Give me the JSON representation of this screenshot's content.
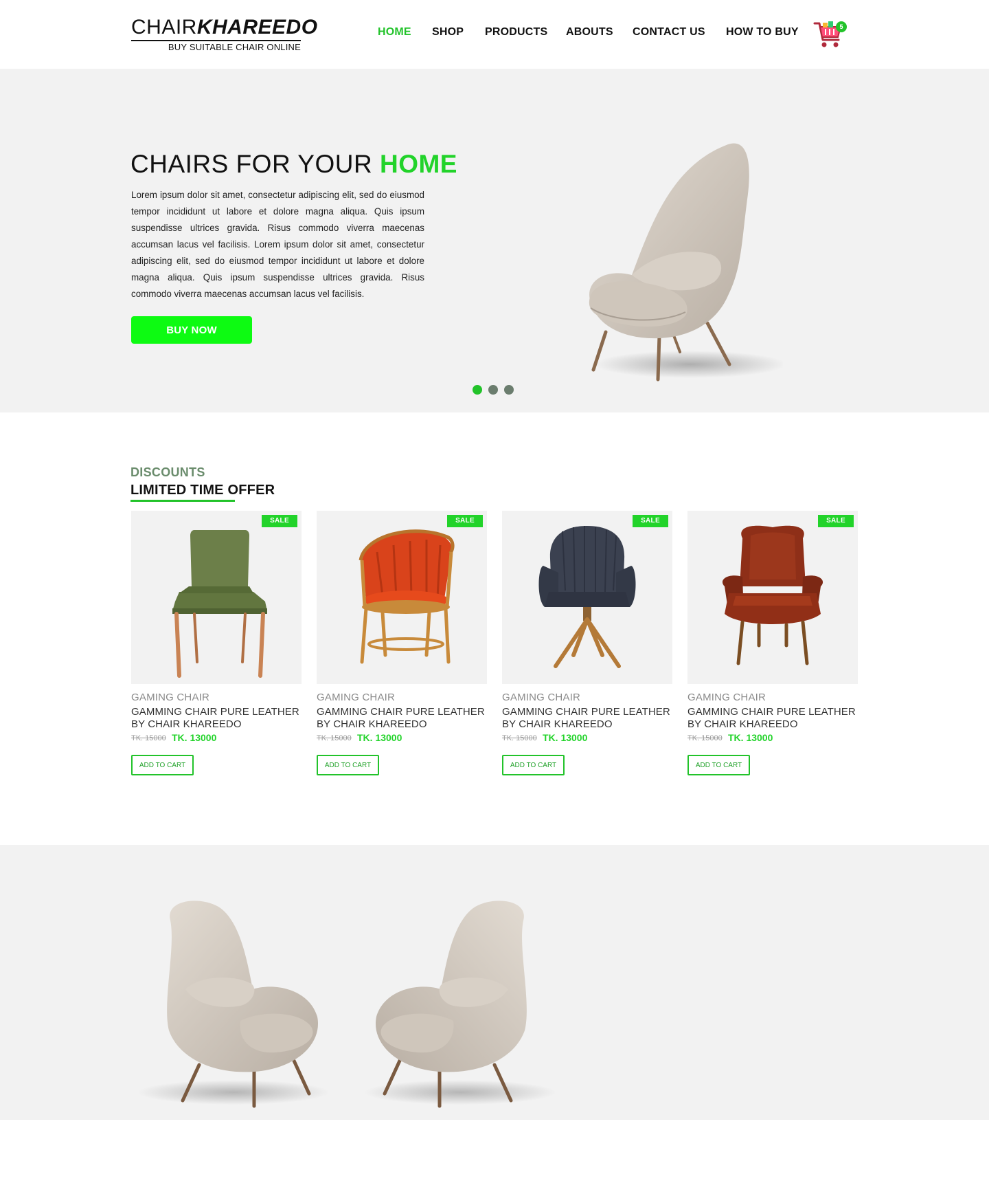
{
  "brand": {
    "name_thin": "CHAIR",
    "name_bold": "KHAREEDO",
    "tagline": "BUY SUITABLE CHAIR ONLINE"
  },
  "nav": {
    "home": "HOME",
    "shop": "SHOP",
    "products": "PRODUCTS",
    "abouts": "ABOUTS",
    "contact": "CONTACT US",
    "howto": "HOW TO BUY"
  },
  "cart": {
    "count": "5",
    "icon": "shopping-cart-icon"
  },
  "hero": {
    "title_plain": "CHAIRS FOR YOUR ",
    "title_accent": "HOME",
    "body": "Lorem ipsum dolor sit amet, consectetur adipiscing elit, sed do eiusmod tempor incididunt ut labore et dolore magna aliqua. Quis ipsum suspendisse ultrices gravida. Risus commodo viverra maecenas accumsan lacus vel facilisis. Lorem ipsum dolor sit amet, consectetur adipiscing elit, sed do eiusmod tempor incididunt ut labore et dolore magna aliqua. Quis ipsum suspendisse ultrices gravida. Risus commodo viverra maecenas accumsan lacus vel facilisis.",
    "button": "BUY NOW",
    "slides": 3,
    "active_slide": 1
  },
  "discounts": {
    "eyebrow": "DISCOUNTS",
    "title": "LIMITED TIME OFFER",
    "products": [
      {
        "badge": "SALE",
        "category": "GAMING CHAIR",
        "name": "GAMMING CHAIR PURE LEATHER BY CHAIR KHAREEDO",
        "old_price": "TK. 15000",
        "price": "TK. 13000",
        "button": "ADD TO CART"
      },
      {
        "badge": "SALE",
        "category": "GAMING CHAIR",
        "name": "GAMMING CHAIR PURE LEATHER BY CHAIR KHAREEDO",
        "old_price": "TK. 15000",
        "price": "TK. 13000",
        "button": "ADD TO CART"
      },
      {
        "badge": "SALE",
        "category": "GAMING CHAIR",
        "name": "GAMMING CHAIR PURE LEATHER BY CHAIR KHAREEDO",
        "old_price": "TK. 15000",
        "price": "TK. 13000",
        "button": "ADD TO CART"
      },
      {
        "badge": "SALE",
        "category": "GAMING CHAIR",
        "name": "GAMMING CHAIR PURE LEATHER BY CHAIR KHAREEDO",
        "old_price": "TK. 15000",
        "price": "TK. 13000",
        "button": "ADD TO CART"
      }
    ]
  },
  "colors": {
    "accent": "#22d32a",
    "button": "#0dfb12",
    "muted_green": "#6a8c6c",
    "panel": "#f2f2f2"
  }
}
